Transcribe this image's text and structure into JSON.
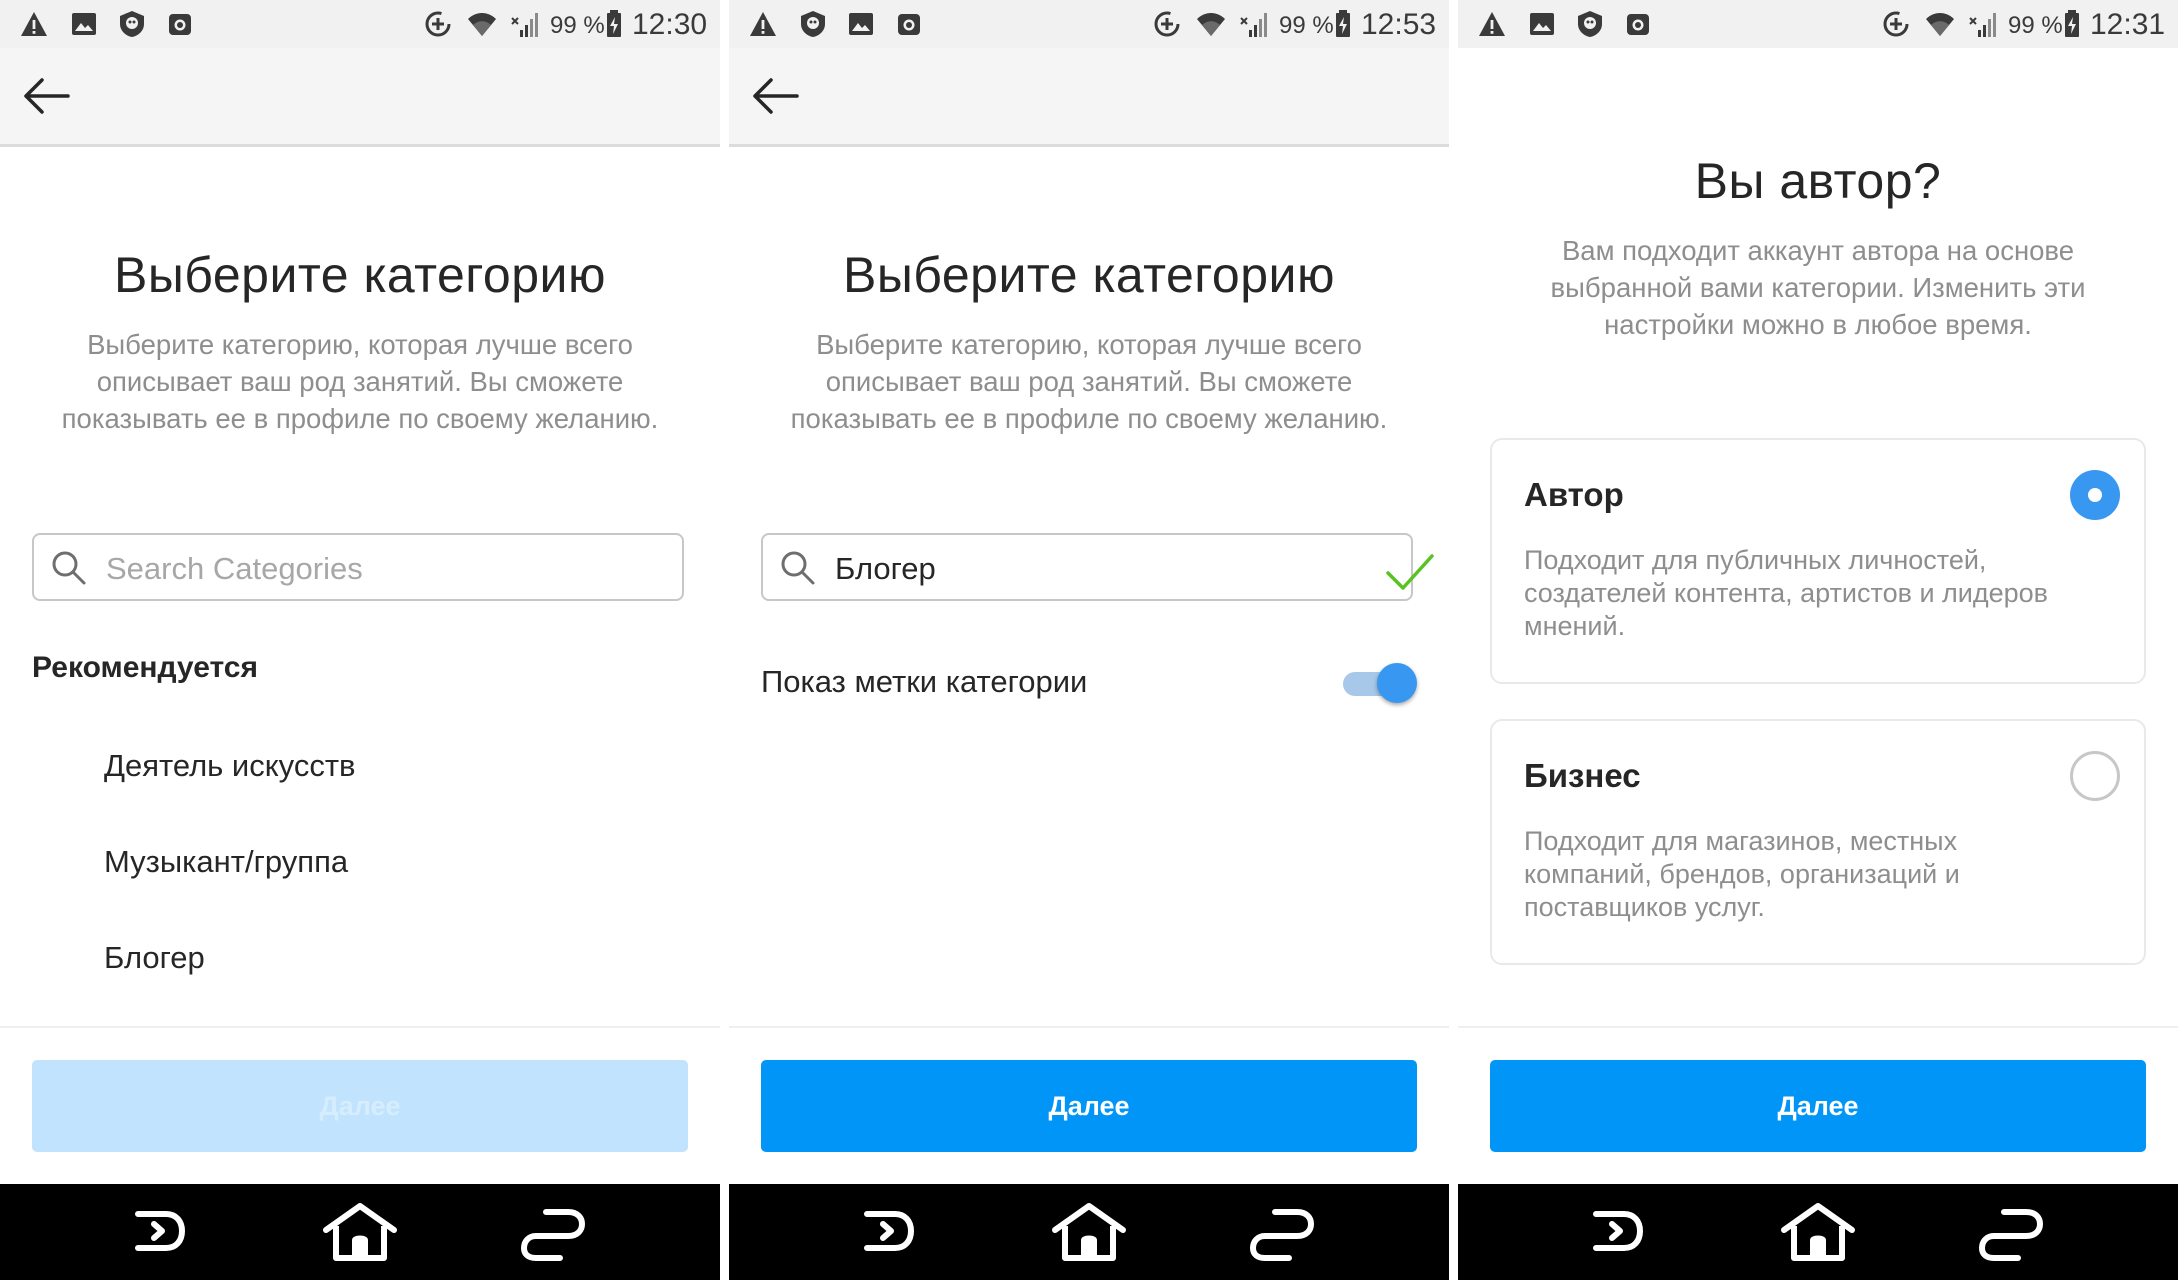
{
  "colors": {
    "accent": "#0095f6",
    "accent_disabled": "#c1e3fd",
    "checkmark": "#58c322"
  },
  "screens": [
    {
      "status": {
        "battery": "99 %",
        "time": "12:30"
      },
      "title": "Выберите категорию",
      "description": [
        "Выберите категорию, которая лучше всего",
        "описывает ваш род занятий. Вы сможете",
        "показывать ее в профиле по своему желанию."
      ],
      "search": {
        "placeholder": "Search Categories",
        "value": ""
      },
      "section": "Рекомендуется",
      "items": [
        "Деятель искусств",
        "Музыкант/группа",
        "Блогер"
      ],
      "button": {
        "label": "Далее",
        "enabled": false
      }
    },
    {
      "status": {
        "battery": "99 %",
        "time": "12:53"
      },
      "title": "Выберите категорию",
      "description": [
        "Выберите категорию, которая лучше всего",
        "описывает ваш род занятий. Вы сможете",
        "показывать ее в профиле по своему желанию."
      ],
      "search": {
        "placeholder": "",
        "value": "Блогер"
      },
      "toggle": {
        "label": "Показ метки категории",
        "on": true
      },
      "button": {
        "label": "Далее",
        "enabled": true
      }
    },
    {
      "status": {
        "battery": "99 %",
        "time": "12:31"
      },
      "title": "Вы автор?",
      "description": [
        "Вам подходит аккаунт автора на основе",
        "выбранной вами категории. Изменить эти",
        "настройки можно в любое время."
      ],
      "options": [
        {
          "title": "Автор",
          "description": [
            "Подходит для публичных личностей,",
            "создателей контента, артистов и лидеров",
            "мнений."
          ],
          "selected": true
        },
        {
          "title": "Бизнес",
          "description": [
            "Подходит для магазинов, местных",
            "компаний, брендов, организаций и",
            "поставщиков услуг."
          ],
          "selected": false
        }
      ],
      "button": {
        "label": "Далее",
        "enabled": true
      }
    }
  ]
}
